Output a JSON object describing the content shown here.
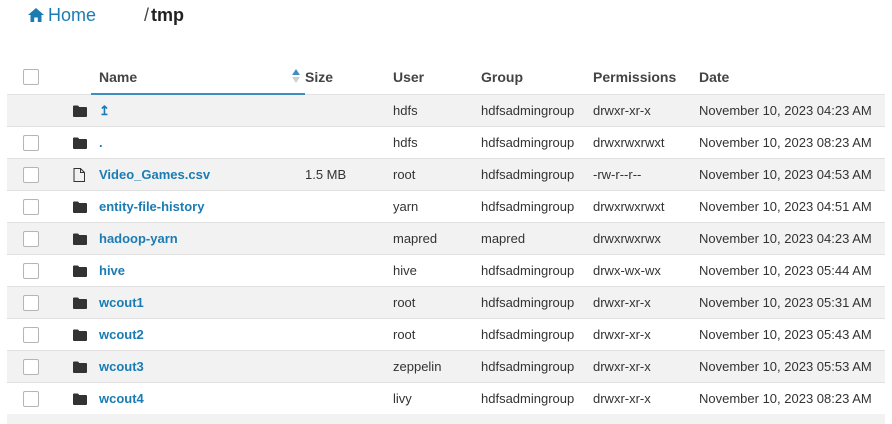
{
  "breadcrumb": {
    "home_label": "Home",
    "separator": "/",
    "current": "tmp"
  },
  "table": {
    "columns": {
      "name": "Name",
      "size": "Size",
      "user": "User",
      "group": "Group",
      "permissions": "Permissions",
      "date": "Date"
    },
    "sort": {
      "column": "name",
      "direction": "ascending"
    },
    "rows": [
      {
        "type": "up",
        "name": "↥",
        "size": "",
        "user": "hdfs",
        "group": "hdfsadmingroup",
        "permissions": "drwxr-xr-x",
        "date": "November 10, 2023 04:23 AM"
      },
      {
        "type": "folder",
        "name": ".",
        "size": "",
        "user": "hdfs",
        "group": "hdfsadmingroup",
        "permissions": "drwxrwxrwxt",
        "date": "November 10, 2023 08:23 AM"
      },
      {
        "type": "file",
        "name": "Video_Games.csv",
        "size": "1.5 MB",
        "user": "root",
        "group": "hdfsadmingroup",
        "permissions": "-rw-r--r--",
        "date": "November 10, 2023 04:53 AM"
      },
      {
        "type": "folder",
        "name": "entity-file-history",
        "size": "",
        "user": "yarn",
        "group": "hdfsadmingroup",
        "permissions": "drwxrwxrwxt",
        "date": "November 10, 2023 04:51 AM"
      },
      {
        "type": "folder",
        "name": "hadoop-yarn",
        "size": "",
        "user": "mapred",
        "group": "mapred",
        "permissions": "drwxrwxrwx",
        "date": "November 10, 2023 04:23 AM"
      },
      {
        "type": "folder",
        "name": "hive",
        "size": "",
        "user": "hive",
        "group": "hdfsadmingroup",
        "permissions": "drwx-wx-wx",
        "date": "November 10, 2023 05:44 AM"
      },
      {
        "type": "folder",
        "name": "wcout1",
        "size": "",
        "user": "root",
        "group": "hdfsadmingroup",
        "permissions": "drwxr-xr-x",
        "date": "November 10, 2023 05:31 AM"
      },
      {
        "type": "folder",
        "name": "wcout2",
        "size": "",
        "user": "root",
        "group": "hdfsadmingroup",
        "permissions": "drwxr-xr-x",
        "date": "November 10, 2023 05:43 AM"
      },
      {
        "type": "folder",
        "name": "wcout3",
        "size": "",
        "user": "zeppelin",
        "group": "hdfsadmingroup",
        "permissions": "drwxr-xr-x",
        "date": "November 10, 2023 05:53 AM"
      },
      {
        "type": "folder",
        "name": "wcout4",
        "size": "",
        "user": "livy",
        "group": "hdfsadmingroup",
        "permissions": "drwxr-xr-x",
        "date": "November 10, 2023 08:23 AM"
      }
    ]
  },
  "colors": {
    "link": "#1b7cb3",
    "row_alt": "#f2f2f2",
    "sort_active": "#3d8fc2"
  },
  "icons": {
    "home": "home-icon",
    "folder": "folder-icon",
    "file": "file-icon",
    "sort": "sort-arrows-icon"
  }
}
